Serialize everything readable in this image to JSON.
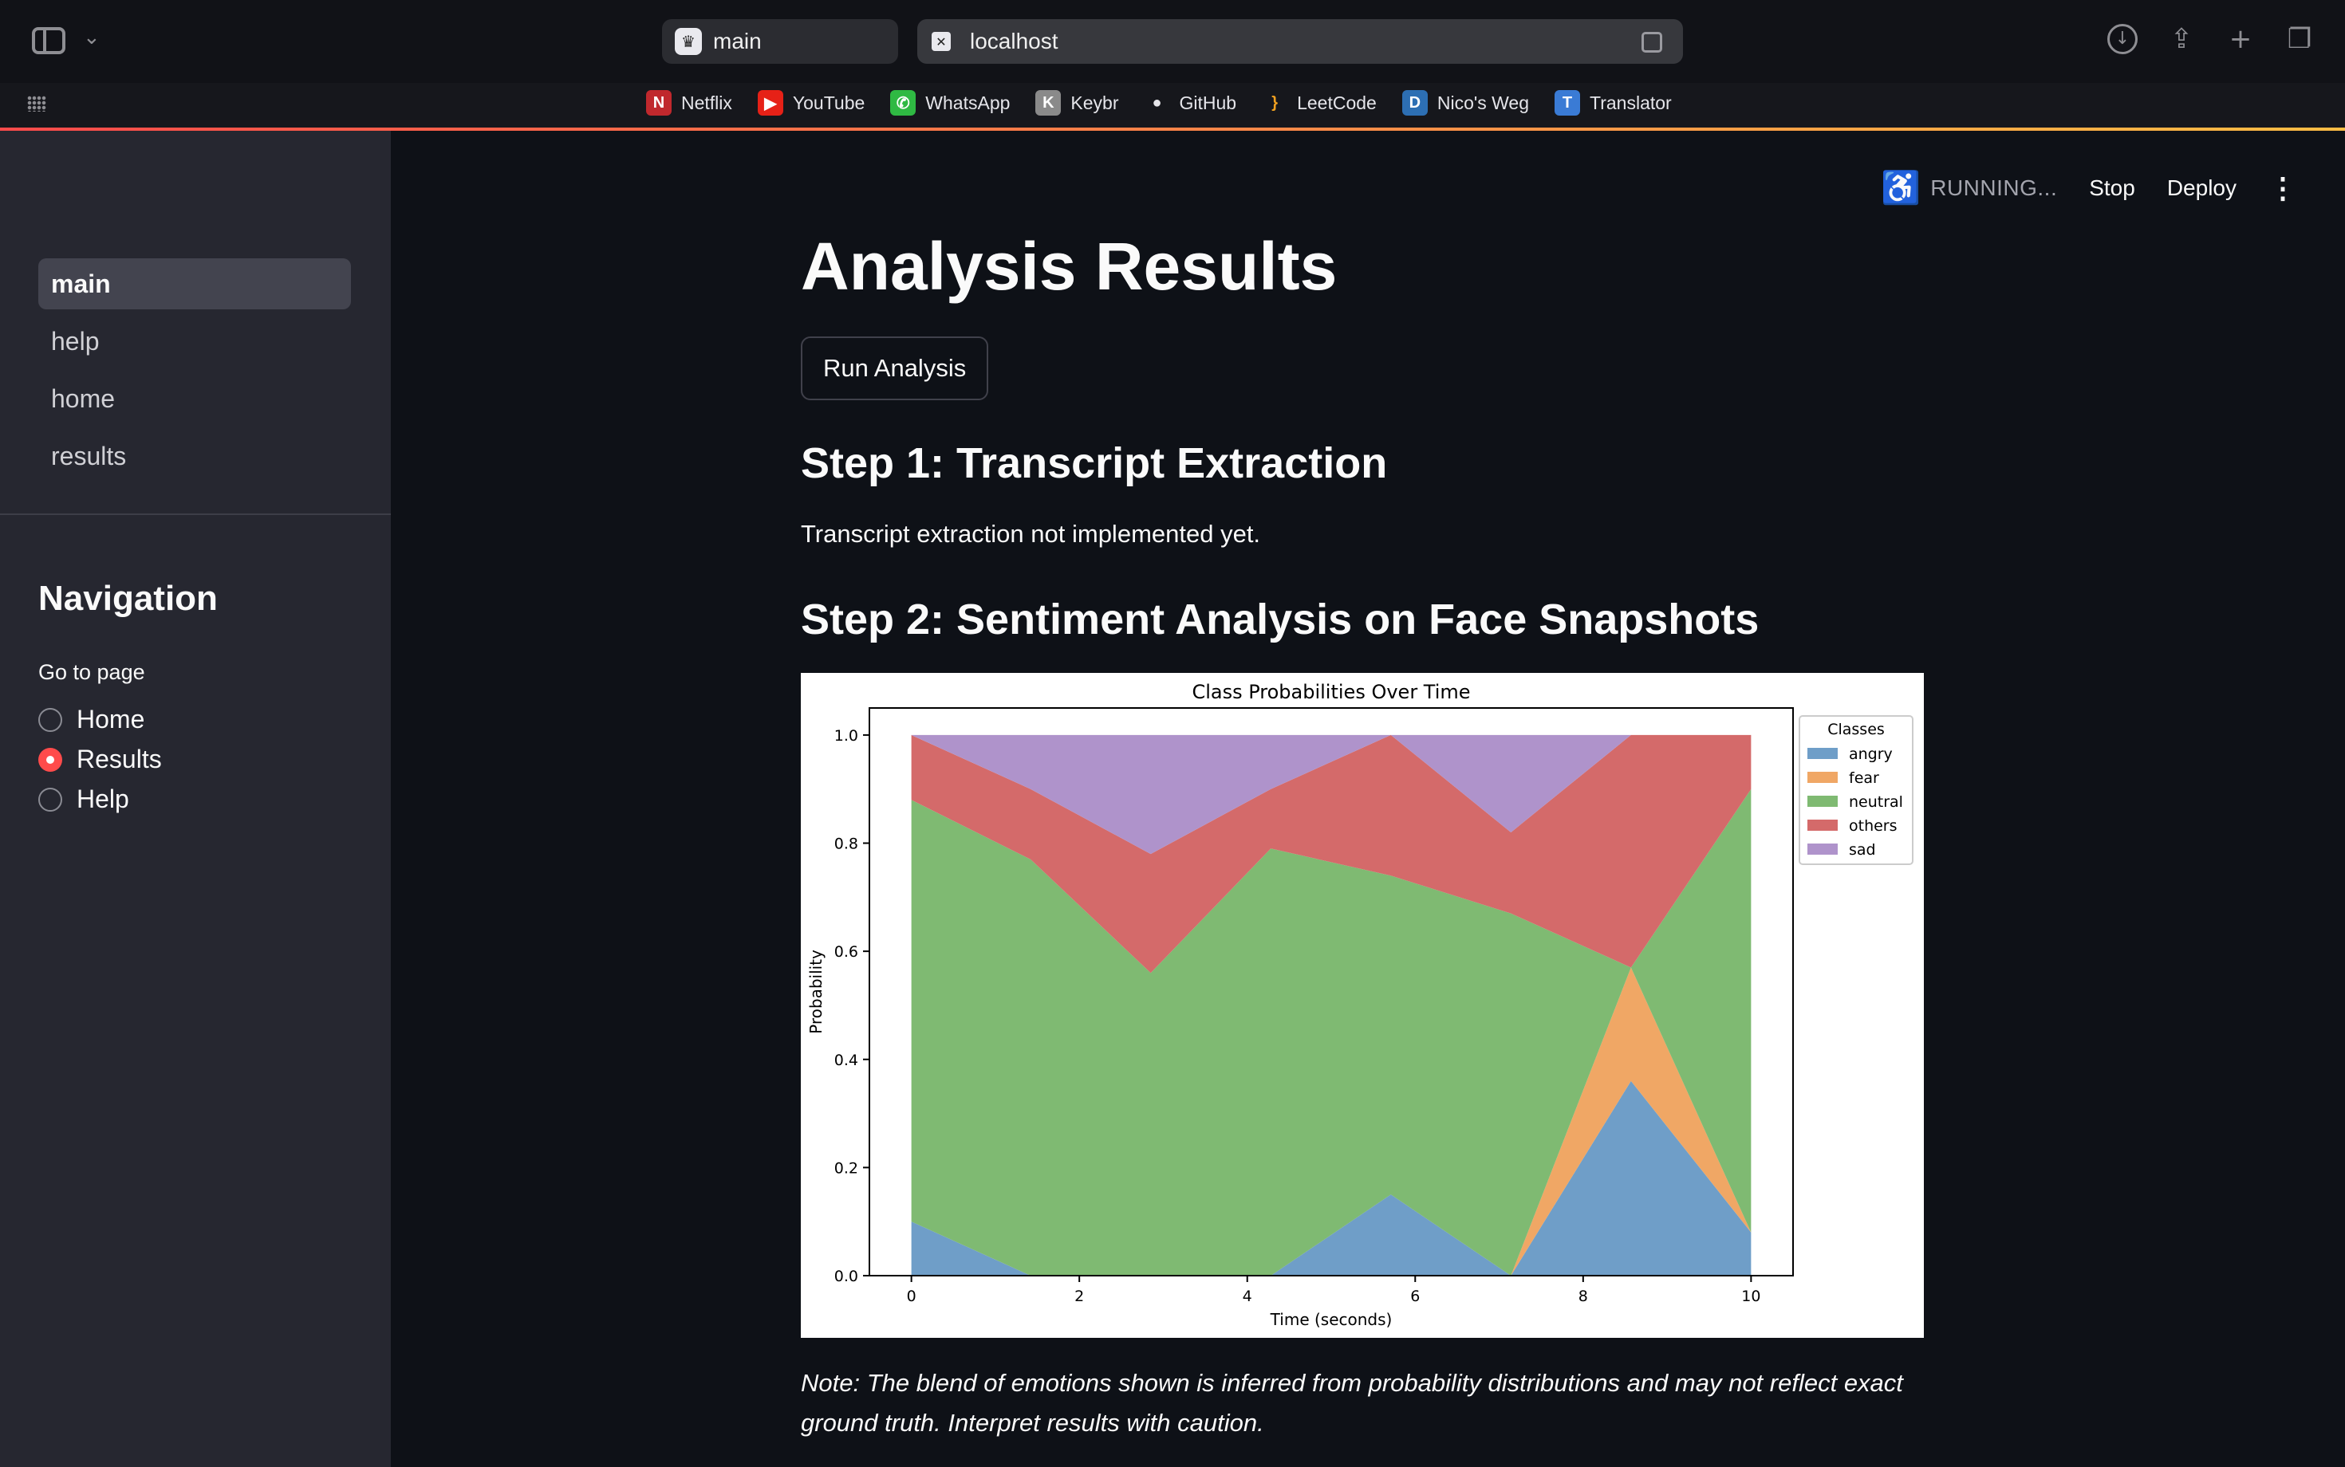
{
  "browser": {
    "tabs": [
      {
        "label": "main"
      },
      {
        "label": "localhost"
      }
    ],
    "bookmarks": [
      {
        "label": "Netflix",
        "icon": "netflix-icon",
        "color": "#c0282d",
        "glyph": "N"
      },
      {
        "label": "YouTube",
        "icon": "youtube-icon",
        "color": "#e62117",
        "glyph": "▶"
      },
      {
        "label": "WhatsApp",
        "icon": "whatsapp-icon",
        "color": "#2fb943",
        "glyph": "✆"
      },
      {
        "label": "Keybr",
        "icon": "keybr-icon",
        "color": "#8a8a8a",
        "glyph": "K"
      },
      {
        "label": "GitHub",
        "icon": "github-icon",
        "color": "#e5e5ea",
        "glyph": "●"
      },
      {
        "label": "LeetCode",
        "icon": "leetcode-icon",
        "color": "#f0a020",
        "glyph": "}"
      },
      {
        "label": "Nico's Weg",
        "icon": "nicos-weg-icon",
        "color": "#2d6fb3",
        "glyph": "D"
      },
      {
        "label": "Translator",
        "icon": "translator-icon",
        "color": "#3a7bd5",
        "glyph": "T"
      }
    ]
  },
  "status": {
    "running": "RUNNING...",
    "stop": "Stop",
    "deploy": "Deploy"
  },
  "sidebar": {
    "pages": [
      {
        "label": "main",
        "active": true
      },
      {
        "label": "help",
        "active": false
      },
      {
        "label": "home",
        "active": false
      },
      {
        "label": "results",
        "active": false
      }
    ],
    "heading": "Navigation",
    "radio_label": "Go to page",
    "radio_options": [
      {
        "label": "Home",
        "checked": false
      },
      {
        "label": "Results",
        "checked": true
      },
      {
        "label": "Help",
        "checked": false
      }
    ]
  },
  "main": {
    "title": "Analysis Results",
    "run_button": "Run Analysis",
    "step1_heading": "Step 1: Transcript Extraction",
    "step1_text": "Transcript extraction not implemented yet.",
    "step2_heading": "Step 2: Sentiment Analysis on Face Snapshots",
    "note": "Note: The blend of emotions shown is inferred from probability distributions and may not reflect exact ground truth. Interpret results with caution."
  },
  "colors": {
    "accent": "#ff4b4b",
    "sidebar_bg": "#262730",
    "main_bg": "#0e1117"
  },
  "chart_data": {
    "type": "area",
    "stacked": true,
    "title": "Class Probabilities Over Time",
    "xlabel": "Time (seconds)",
    "ylabel": "Probability",
    "xlim": [
      -0.5,
      10.5
    ],
    "ylim": [
      0,
      1.05
    ],
    "xticks": [
      "0",
      "2",
      "4",
      "6",
      "8",
      "10"
    ],
    "yticks": [
      "0.0",
      "0.2",
      "0.4",
      "0.6",
      "0.8",
      "1.0"
    ],
    "legend_title": "Classes",
    "legend_position": "outside-right",
    "x": [
      0,
      1.42,
      2.85,
      4.28,
      5.71,
      7.14,
      8.57,
      10
    ],
    "series": [
      {
        "name": "angry",
        "color": "#6f9ec8",
        "values": [
          0.1,
          0.0,
          0.0,
          0.0,
          0.15,
          0.0,
          0.36,
          0.08
        ]
      },
      {
        "name": "fear",
        "color": "#f0a765",
        "values": [
          0.0,
          0.0,
          0.0,
          0.0,
          0.0,
          0.0,
          0.21,
          0.0
        ]
      },
      {
        "name": "neutral",
        "color": "#7fba72",
        "values": [
          0.78,
          0.77,
          0.56,
          0.79,
          0.59,
          0.67,
          0.0,
          0.82
        ]
      },
      {
        "name": "others",
        "color": "#d46a6a",
        "values": [
          0.12,
          0.13,
          0.22,
          0.11,
          0.26,
          0.15,
          0.43,
          0.1
        ]
      },
      {
        "name": "sad",
        "color": "#af93cb",
        "values": [
          0.0,
          0.1,
          0.22,
          0.1,
          0.0,
          0.18,
          0.0,
          0.0
        ]
      }
    ]
  }
}
